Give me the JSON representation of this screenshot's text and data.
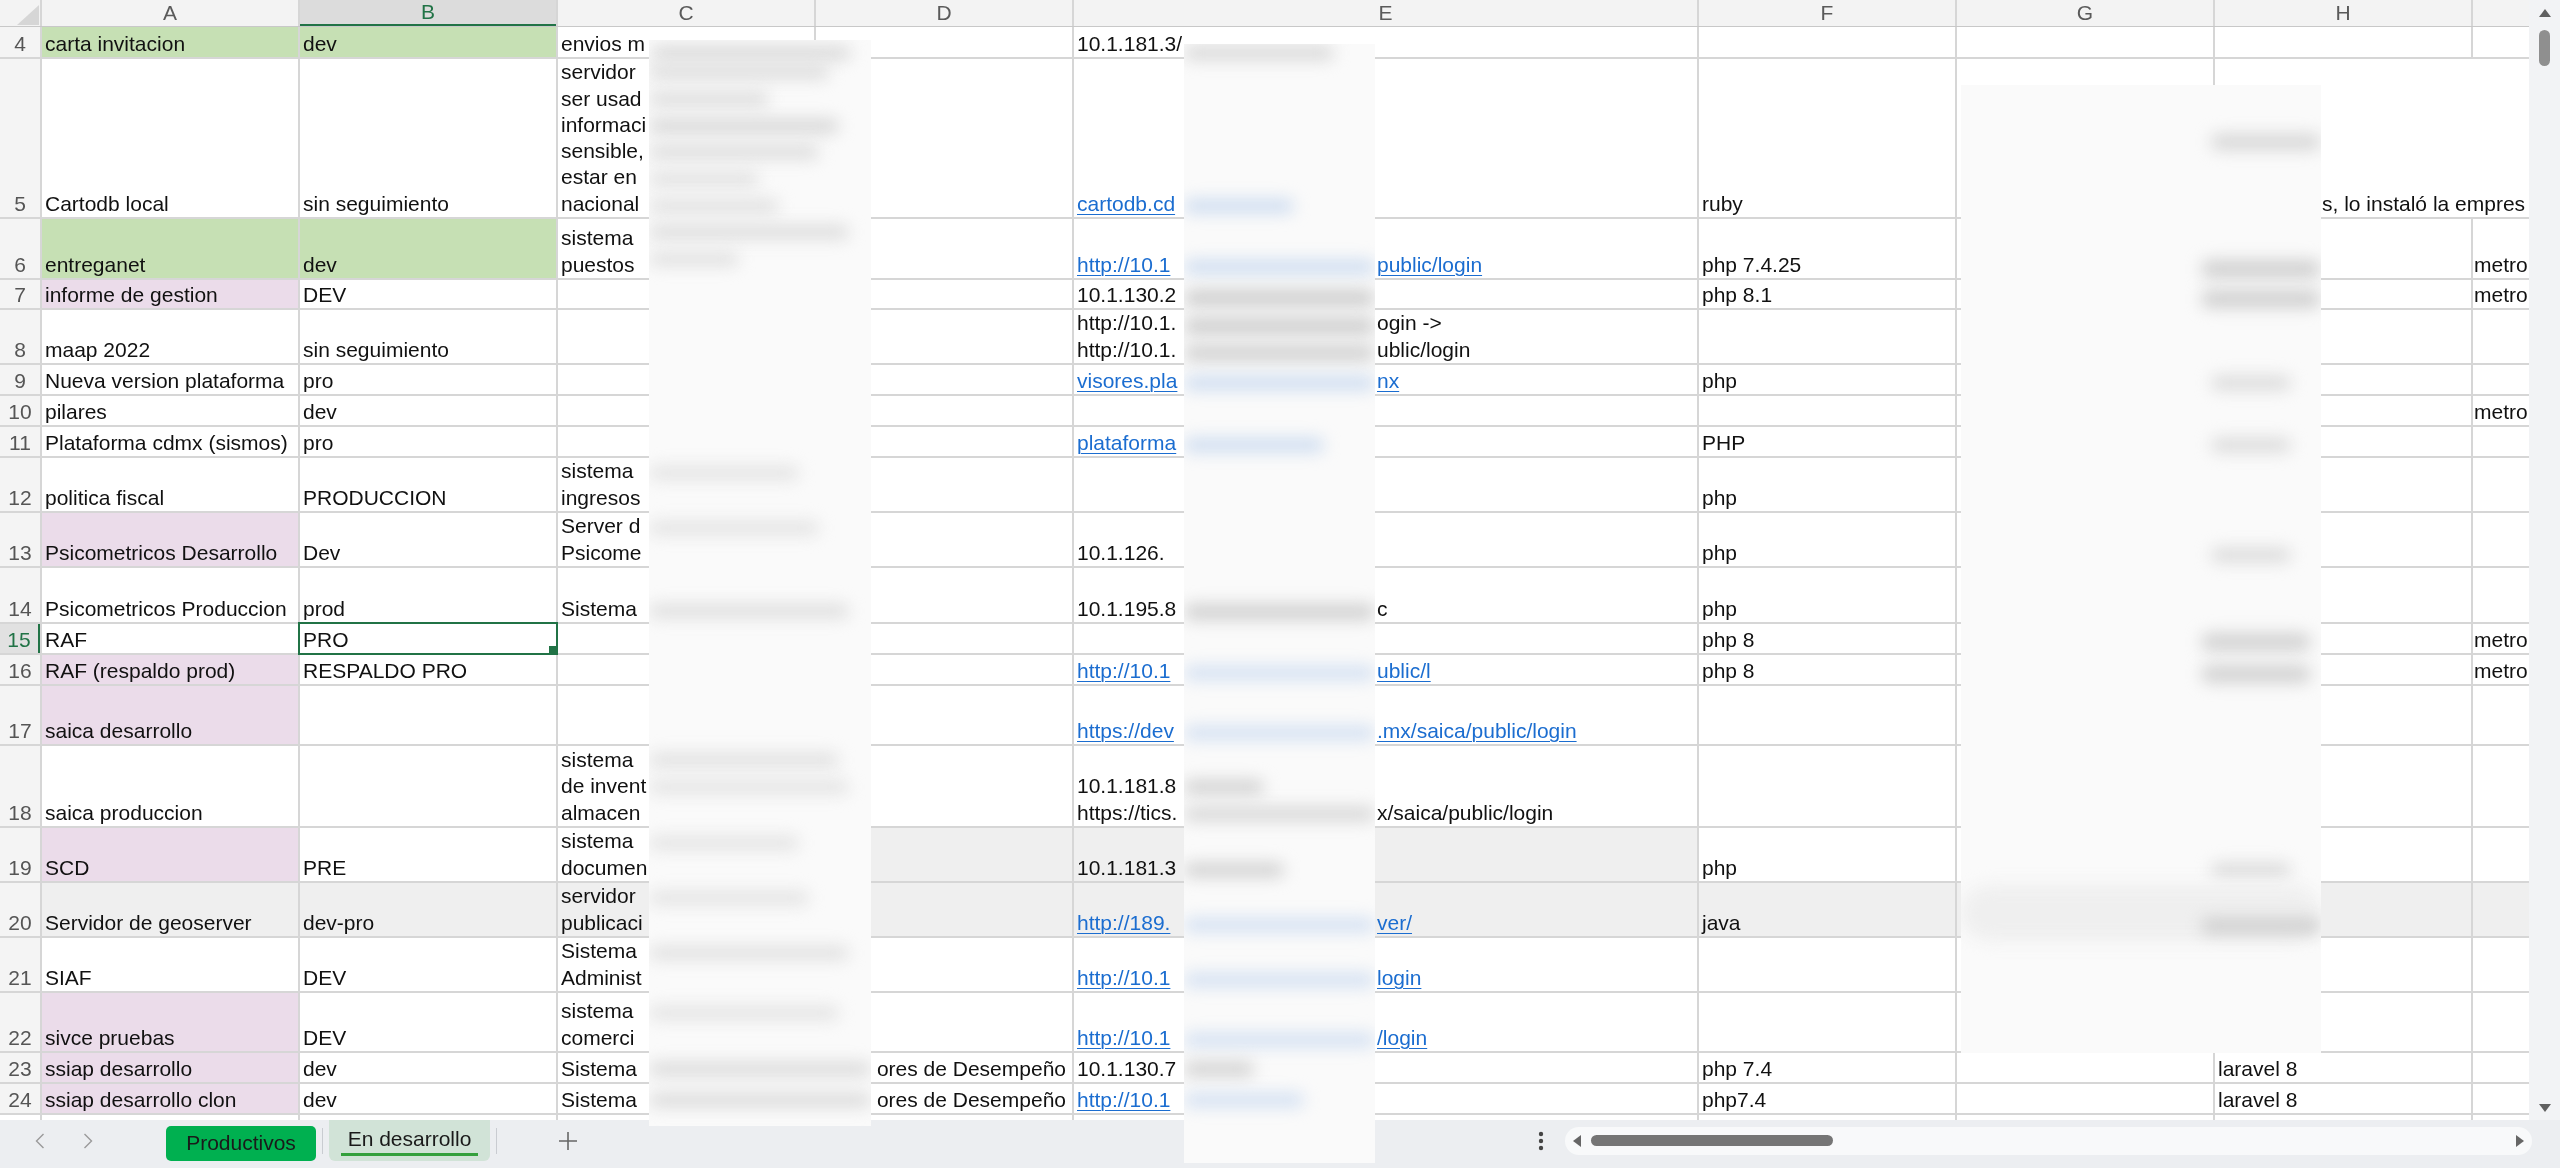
{
  "column_headers": [
    {
      "label": "A",
      "selected": false
    },
    {
      "label": "B",
      "selected": true
    },
    {
      "label": "C",
      "selected": false
    },
    {
      "label": "D",
      "selected": false
    },
    {
      "label": "E",
      "selected": false
    },
    {
      "label": "F",
      "selected": false
    },
    {
      "label": "G",
      "selected": false
    },
    {
      "label": "H",
      "selected": false
    }
  ],
  "rows": [
    {
      "number": "4",
      "selected": false,
      "cells": {
        "a": {
          "text": "carta invitacion",
          "color": "#c6e0b4"
        },
        "b": {
          "text": "dev",
          "color": "#c6e0b4"
        },
        "c": {
          "text": "envios m"
        },
        "e": {
          "text": "10.1.181.3/",
          "link": false
        }
      }
    },
    {
      "number": "5",
      "selected": false,
      "cells": {
        "a": {
          "text": "Cartodb local"
        },
        "b": {
          "text": "sin seguimiento"
        },
        "c": {
          "lines": [
            "servidor",
            "ser usad",
            "informaci",
            "sensible,",
            "estar en",
            "nacional"
          ]
        },
        "e": {
          "text": "cartodb.cd",
          "link": true
        },
        "f": {
          "text": "ruby"
        },
        "h": {
          "end": "s, lo instaló la empres"
        }
      }
    },
    {
      "number": "6",
      "selected": false,
      "cells": {
        "a": {
          "text": "entreganet",
          "color": "#c6e0b4"
        },
        "b": {
          "text": "dev",
          "color": "#c6e0b4"
        },
        "c": {
          "lines": [
            "sistema",
            "puestos"
          ]
        },
        "e": {
          "text": "http://10.1",
          "end": "public/login",
          "link": true
        },
        "f": {
          "text": "php 7.4.25"
        },
        "i": {
          "text": "metro"
        }
      }
    },
    {
      "number": "7",
      "selected": false,
      "cells": {
        "a": {
          "text": "informe de gestion",
          "color": "#ebdcea"
        },
        "b": {
          "text": "DEV"
        },
        "e": {
          "text": "10.1.130.2",
          "link": false
        },
        "f": {
          "text": "php 8.1"
        },
        "i": {
          "text": "metro"
        }
      }
    },
    {
      "number": "8",
      "selected": false,
      "cells": {
        "a": {
          "text": "maap 2022"
        },
        "b": {
          "text": "sin seguimiento"
        },
        "e": {
          "lines": [
            {
              "text": "http://10.1.",
              "end": "ogin ->"
            },
            {
              "text": "http://10.1.",
              "end": "ublic/login"
            }
          ],
          "link": false
        }
      }
    },
    {
      "number": "9",
      "selected": false,
      "cells": {
        "a": {
          "text": "Nueva version plataforma"
        },
        "b": {
          "text": "pro"
        },
        "e": {
          "text": "visores.pla",
          "end": "nx",
          "link": true
        },
        "f": {
          "text": "php"
        }
      }
    },
    {
      "number": "10",
      "selected": false,
      "cells": {
        "a": {
          "text": "pilares"
        },
        "b": {
          "text": "dev"
        },
        "i": {
          "text": "metro"
        }
      }
    },
    {
      "number": "11",
      "selected": false,
      "cells": {
        "a": {
          "text": "Plataforma cdmx (sismos)"
        },
        "b": {
          "text": "pro"
        },
        "e": {
          "text": "plataforma",
          "link": true
        },
        "f": {
          "text": "PHP"
        }
      }
    },
    {
      "number": "12",
      "selected": false,
      "cells": {
        "a": {
          "text": "politica fiscal"
        },
        "b": {
          "text": "PRODUCCION"
        },
        "c": {
          "lines": [
            "sistema",
            "ingresos"
          ]
        },
        "f": {
          "text": "php"
        }
      }
    },
    {
      "number": "13",
      "selected": false,
      "cells": {
        "a": {
          "text": "Psicometricos Desarrollo",
          "color": "#ebdcea"
        },
        "b": {
          "text": "Dev"
        },
        "c": {
          "lines": [
            "Server d",
            "Psicome"
          ]
        },
        "e": {
          "text": "10.1.126.",
          "link": false
        },
        "f": {
          "text": "php"
        }
      }
    },
    {
      "number": "14",
      "selected": false,
      "cells": {
        "a": {
          "text": "Psicometricos Produccion"
        },
        "b": {
          "text": "prod"
        },
        "c": {
          "text": "Sistema"
        },
        "e": {
          "text": "10.1.195.8",
          "end": "c",
          "link": false
        },
        "f": {
          "text": "php"
        }
      }
    },
    {
      "number": "15",
      "selected": true,
      "cells": {
        "a": {
          "text": "RAF"
        },
        "b": {
          "text": "PRO"
        },
        "f": {
          "text": "php 8"
        },
        "i": {
          "text": "metro"
        }
      }
    },
    {
      "number": "16",
      "selected": false,
      "cells": {
        "a": {
          "text": "RAF (respaldo prod)",
          "color": "#ebdcea"
        },
        "b": {
          "text": "RESPALDO PRO"
        },
        "e": {
          "text": "http://10.1",
          "end": "ublic/l",
          "link": true
        },
        "f": {
          "text": "php 8"
        },
        "i": {
          "text": "metro"
        }
      }
    },
    {
      "number": "17",
      "selected": false,
      "cells": {
        "a": {
          "text": "saica desarrollo",
          "color": "#ebdcea"
        },
        "e": {
          "text": "https://dev",
          "end": ".mx/saica/public/login",
          "link": true
        }
      }
    },
    {
      "number": "18",
      "selected": false,
      "cells": {
        "a": {
          "text": "saica produccion"
        },
        "c": {
          "lines": [
            "sistema",
            "de invent",
            "almacen"
          ]
        },
        "e": {
          "lines": [
            {
              "text": "10.1.181.8"
            },
            {
              "text": "https://tics.",
              "end": "x/saica/public/login"
            }
          ],
          "link": false
        }
      }
    },
    {
      "number": "19",
      "selected": false,
      "cells": {
        "a": {
          "text": "SCD",
          "color": "#ebdcea"
        },
        "b": {
          "text": "PRE"
        },
        "c": {
          "lines": [
            "sistema",
            "documen"
          ]
        },
        "d": {
          "color": "#efefef"
        },
        "e": {
          "text": "10.1.181.3",
          "link": false,
          "color": "#efefef"
        },
        "f": {
          "text": "php"
        }
      }
    },
    {
      "number": "20",
      "selected": false,
      "color": "#efefef",
      "cells": {
        "a": {
          "text": "Servidor de geoserver"
        },
        "b": {
          "text": "dev-pro"
        },
        "c": {
          "lines": [
            "servidor",
            "publicaci"
          ]
        },
        "e": {
          "text": "http://189.",
          "end": "ver/",
          "link": true
        },
        "f": {
          "text": "java"
        }
      }
    },
    {
      "number": "21",
      "selected": false,
      "cells": {
        "a": {
          "text": "SIAF"
        },
        "b": {
          "text": "DEV"
        },
        "c": {
          "lines": [
            "Sistema",
            "Administ"
          ]
        },
        "e": {
          "text": "http://10.1",
          "end": "login",
          "link": true
        }
      }
    },
    {
      "number": "22",
      "selected": false,
      "cells": {
        "a": {
          "text": "sivce pruebas",
          "color": "#ebdcea"
        },
        "b": {
          "text": "DEV"
        },
        "c": {
          "lines": [
            "sistema",
            "comerci"
          ]
        },
        "e": {
          "text": "http://10.1",
          "end": "/login",
          "link": true
        }
      }
    },
    {
      "number": "23",
      "selected": false,
      "cells": {
        "a": {
          "text": "ssiap desarrollo",
          "color": "#ebdcea"
        },
        "b": {
          "text": "dev"
        },
        "c": {
          "text": "Sistema"
        },
        "d": {
          "text": "ores de Desempeño"
        },
        "e": {
          "text": "10.1.130.7",
          "link": false
        },
        "f": {
          "text": "php 7.4"
        },
        "h": {
          "text": "laravel 8"
        }
      }
    },
    {
      "number": "24",
      "selected": false,
      "cells": {
        "a": {
          "text": "ssiap desarrollo clon",
          "color": "#ebdcea"
        },
        "b": {
          "text": "dev"
        },
        "c": {
          "text": "Sistema"
        },
        "d": {
          "text": "ores de Desempeño"
        },
        "e": {
          "text": "http://10.1",
          "link": true
        },
        "f": {
          "text": "php7.4"
        },
        "h": {
          "text": "laravel 8"
        }
      }
    }
  ],
  "sheet_tabs": [
    {
      "label": "Productivos",
      "selected": false,
      "color": "#00b050"
    },
    {
      "label": "En desarrollo",
      "selected": true,
      "color": "#34a03c"
    }
  ]
}
